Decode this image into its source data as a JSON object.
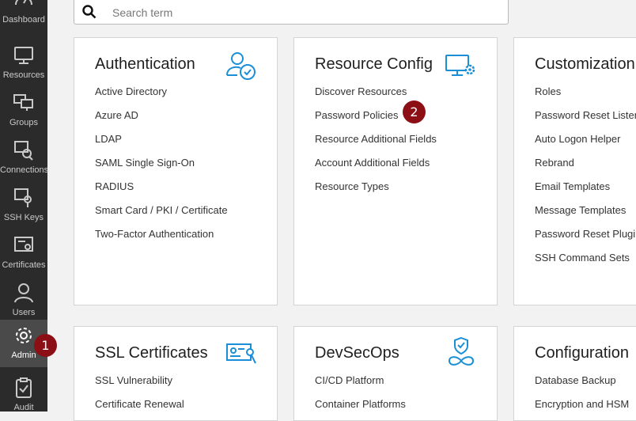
{
  "sidebar": {
    "items": [
      {
        "label": "Dashboard",
        "icon": "dashboard-gauge-icon"
      },
      {
        "label": "Resources",
        "icon": "monitor-icon"
      },
      {
        "label": "Groups",
        "icon": "group-monitors-icon"
      },
      {
        "label": "Connections",
        "icon": "connection-icon"
      },
      {
        "label": "SSH Keys",
        "icon": "ssh-key-icon"
      },
      {
        "label": "Certificates",
        "icon": "certificate-icon"
      },
      {
        "label": "Users",
        "icon": "user-icon"
      },
      {
        "label": "Admin",
        "icon": "gear-icon",
        "active": true
      },
      {
        "label": "Audit",
        "icon": "clipboard-check-icon"
      }
    ]
  },
  "search": {
    "placeholder": "Search term",
    "value": "",
    "icon": "search-icon"
  },
  "badges": {
    "one": "1",
    "two": "2"
  },
  "colors": {
    "accent": "#1a8fd8",
    "sidebar": "#2b2b2b",
    "badge": "#8b0f14"
  },
  "cards": [
    {
      "title": "Authentication",
      "icon": "user-check-icon",
      "links": [
        "Active Directory",
        "Azure AD",
        "LDAP",
        "SAML Single Sign-On",
        "RADIUS",
        "Smart Card / PKI / Certificate",
        "Two-Factor Authentication"
      ]
    },
    {
      "title": "Resource Config",
      "icon": "monitor-gear-icon",
      "links": [
        "Discover Resources",
        "Password Policies",
        "Resource Additional Fields",
        "Account Additional Fields",
        "Resource Types"
      ]
    },
    {
      "title": "Customization",
      "icon": "",
      "links": [
        "Roles",
        "Password Reset Listeners",
        "Auto Logon Helper",
        "Rebrand",
        "Email Templates",
        "Message Templates",
        "Password Reset Plugins",
        "SSH Command Sets"
      ]
    },
    {
      "title": "SSL Certificates",
      "icon": "id-card-key-icon",
      "links": [
        "SSL Vulnerability",
        "Certificate Renewal"
      ]
    },
    {
      "title": "DevSecOps",
      "icon": "shield-infinity-icon",
      "links": [
        "CI/CD Platform",
        "Container Platforms"
      ]
    },
    {
      "title": "Configuration",
      "icon": "",
      "links": [
        "Database Backup",
        "Encryption and HSM"
      ]
    }
  ]
}
